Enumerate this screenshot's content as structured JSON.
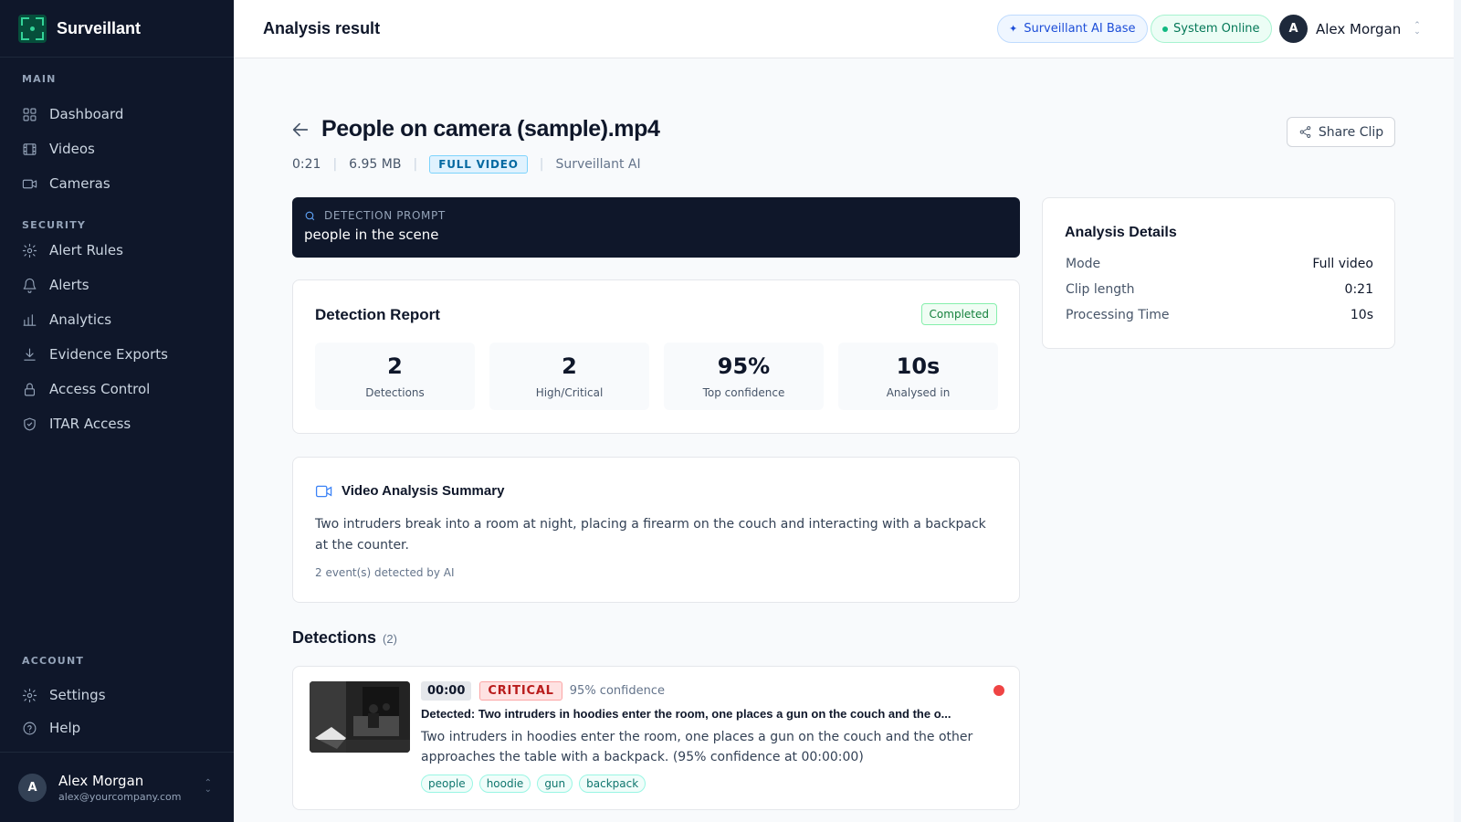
{
  "app": {
    "name": "Surveillant"
  },
  "sidebar": {
    "sections": {
      "main": "MAIN",
      "security": "SECURITY",
      "account": "ACCOUNT"
    },
    "main_items": [
      {
        "label": "Dashboard",
        "icon": "grid-icon"
      },
      {
        "label": "Videos",
        "icon": "film-icon"
      },
      {
        "label": "Cameras",
        "icon": "camera-icon"
      }
    ],
    "security_items": [
      {
        "label": "Alert Rules",
        "icon": "gear-icon"
      },
      {
        "label": "Alerts",
        "icon": "bell-icon"
      },
      {
        "label": "Analytics",
        "icon": "bar-chart-icon"
      },
      {
        "label": "Evidence Exports",
        "icon": "download-icon"
      },
      {
        "label": "Access Control",
        "icon": "lock-icon"
      },
      {
        "label": "ITAR Access",
        "icon": "shield-check-icon"
      }
    ],
    "account_items": [
      {
        "label": "Settings",
        "icon": "gear-icon"
      },
      {
        "label": "Help",
        "icon": "help-circle-icon"
      }
    ],
    "user": {
      "initial": "A",
      "name": "Alex Morgan",
      "email": "alex@yourcompany.com"
    }
  },
  "header": {
    "title": "Analysis result",
    "ai_badge": "Surveillant AI Base",
    "status_badge": "System Online",
    "user": {
      "initial": "A",
      "name": "Alex Morgan"
    }
  },
  "file": {
    "title": "People on camera (sample).mp4",
    "duration": "0:21",
    "size": "6.95 MB",
    "mode_badge": "FULL VIDEO",
    "source": "Surveillant AI",
    "share_label": "Share Clip"
  },
  "prompt": {
    "label": "DETECTION PROMPT",
    "text": "people in the scene"
  },
  "report": {
    "title": "Detection Report",
    "status": "Completed",
    "stats": [
      {
        "value": "2",
        "label": "Detections"
      },
      {
        "value": "2",
        "label": "High/Critical"
      },
      {
        "value": "95%",
        "label": "Top confidence"
      },
      {
        "value": "10s",
        "label": "Analysed in"
      }
    ]
  },
  "details": {
    "title": "Analysis Details",
    "rows": [
      {
        "key": "Mode",
        "value": "Full video"
      },
      {
        "key": "Clip length",
        "value": "0:21"
      },
      {
        "key": "Processing Time",
        "value": "10s"
      }
    ]
  },
  "summary": {
    "title": "Video Analysis Summary",
    "body": "Two intruders break into a room at night, placing a firearm on the couch and interacting with a backpack at the counter.",
    "footer": "2 event(s) detected by AI"
  },
  "detections": {
    "heading": "Detections",
    "count": "(2)",
    "items": [
      {
        "timestamp": "00:00",
        "severity": "CRITICAL",
        "confidence": "95% confidence",
        "title": "Detected: Two intruders in hoodies enter the room, one places a gun on the couch and the o...",
        "description": "Two intruders in hoodies enter the room, one places a gun on the couch and the other approaches the table with a backpack. (95% confidence at 00:00:00)",
        "tags": [
          "people",
          "hoodie",
          "gun",
          "backpack"
        ]
      }
    ]
  },
  "colors": {
    "sidebar_bg": "#0f172a",
    "accent_green": "#34d399",
    "critical_red": "#ef4444",
    "info_blue": "#3b82f6"
  }
}
